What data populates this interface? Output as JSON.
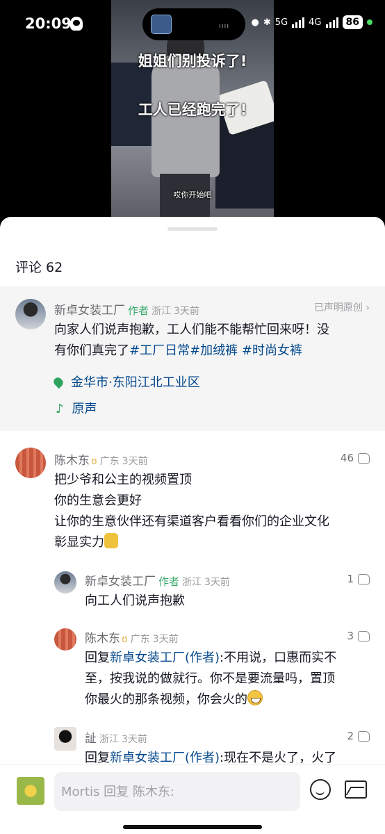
{
  "status_bar": {
    "time": "20:09",
    "net1": "5G",
    "net2": "4G",
    "battery": "86"
  },
  "video": {
    "caption_line1": "姐姐们别投诉了!",
    "caption_line2": "工人已经跑完了!",
    "subtitle": "哎你开始吧"
  },
  "comments_header": {
    "label": "评论 62"
  },
  "post": {
    "author": "新卓女装工厂",
    "author_tag": "作者",
    "region": "浙江",
    "time": "3天前",
    "claim": "已声明原创",
    "text_line1": "向家人们说声抱歉，工人们能不能帮忙回来呀！没",
    "text_line2_prefix": "有你们真完了",
    "hashtags": [
      "#工厂日常",
      "#加绒裤",
      "#时尚女裤"
    ],
    "location": "金华市·东阳江北工业区",
    "music": "原声"
  },
  "comments": [
    {
      "author": "陈木东",
      "region": "广东",
      "time": "3天前",
      "likes": "46",
      "lines": [
        "把少爷和公主的视频置顶",
        "你的生意会更好",
        "让你的生意伙伴还有渠道客户看看你们的企业文化",
        "彰显实力"
      ]
    }
  ],
  "replies": [
    {
      "author": "新卓女装工厂",
      "author_tag": "作者",
      "region": "浙江",
      "time": "3天前",
      "likes": "1",
      "text": "向工人们说声抱歉"
    },
    {
      "author": "陈木东",
      "region": "广东",
      "time": "3天前",
      "likes": "3",
      "reply_prefix": "回复",
      "reply_target": "新卓女装工厂(作者)",
      "line1": ":不用说，口惠而实不",
      "line2": "至，按我说的做就行。你不是要流量吗，置顶",
      "line3": "你最火的那条视频，你会火的"
    },
    {
      "author": "訨",
      "region": "浙江",
      "time": "3天前",
      "likes": "2",
      "reply_prefix": "回复",
      "reply_target": "新卓女装工厂(作者)",
      "line1": ":现在不是火了，火了"
    }
  ],
  "input": {
    "placeholder": "Mortis 回复 陈木东:"
  }
}
